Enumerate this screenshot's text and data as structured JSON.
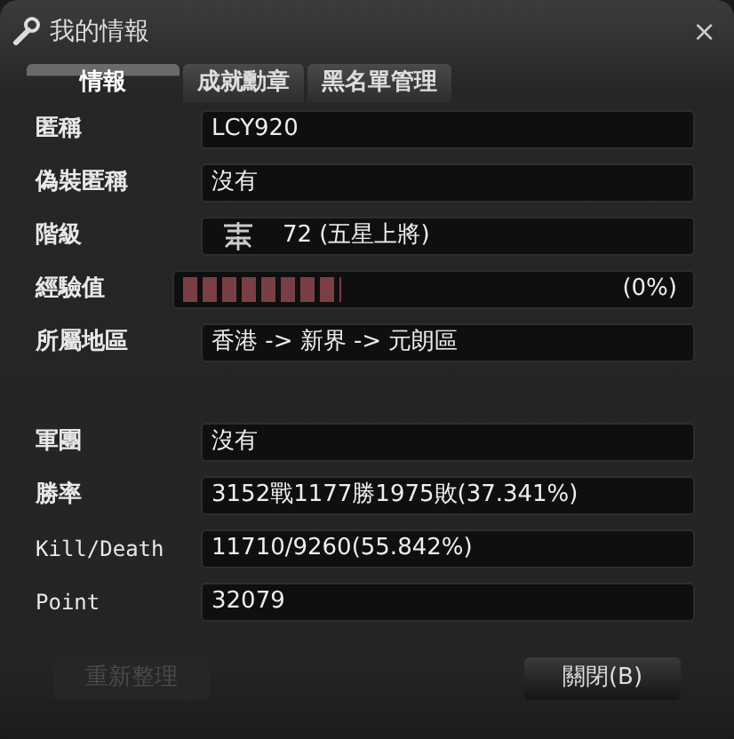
{
  "window": {
    "title": "我的情報",
    "close": "×"
  },
  "tabs": [
    {
      "label": "情報",
      "selected": true
    },
    {
      "label": "成就勳章",
      "selected": false
    },
    {
      "label": "黑名單管理",
      "selected": false
    }
  ],
  "fields": [
    {
      "kind": "text",
      "label": "匿稱",
      "value": "LCY920"
    },
    {
      "kind": "text",
      "label": "偽裝匿稱",
      "value": "沒有"
    },
    {
      "kind": "rank",
      "label": "階級",
      "value": "72 (五星上將)"
    },
    {
      "kind": "meter",
      "label": "經驗值",
      "level": 0.36,
      "value": "(0%)"
    },
    {
      "kind": "text",
      "label": "所屬地區",
      "value": "香港 -> 新界 -> 元朗區"
    }
  ],
  "stats": [
    {
      "kind": "text",
      "label": "軍團",
      "value": "沒有"
    },
    {
      "kind": "text",
      "label": "勝率",
      "value": "3152戰1177勝1975敗(37.341%)"
    },
    {
      "kind": "mono",
      "label": "Kill/Death",
      "value": "11710/9260(55.842%)"
    },
    {
      "kind": "mono",
      "label": "Point",
      "value": "32079"
    }
  ],
  "buttons": [
    {
      "label": "重新整理",
      "disabled": true
    },
    {
      "label": "關閉(B)",
      "disabled": false
    }
  ]
}
